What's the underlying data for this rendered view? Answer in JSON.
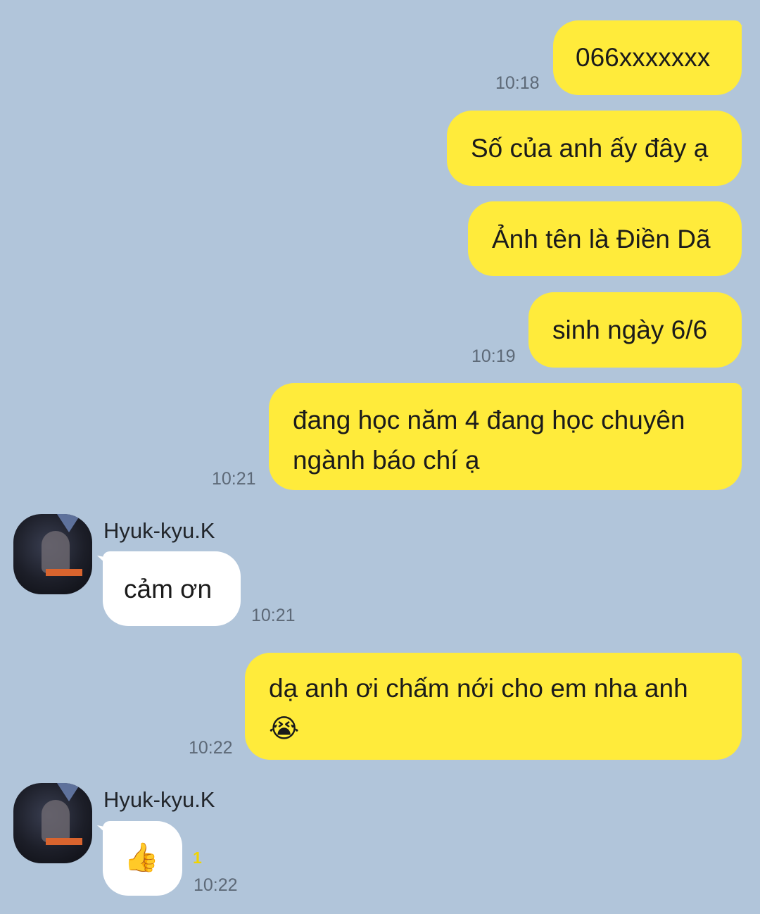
{
  "messages": [
    {
      "text": "066xxxxxxx",
      "time": "10:18"
    },
    {
      "text": "Số của anh ấy đây ạ"
    },
    {
      "text": "Ảnh tên là Điền Dã"
    },
    {
      "text": "sinh ngày 6/6",
      "time": "10:19"
    },
    {
      "line1": "đang học năm 4 đang học chuyên",
      "line2": "ngành báo chí ạ",
      "time": "10:21"
    },
    {
      "sender": "Hyuk-kyu.K",
      "text": "cảm ơn",
      "time": "10:21"
    },
    {
      "line1": "dạ anh ơi chấm nới cho em nha anh",
      "line2": "😭",
      "time": "10:22"
    },
    {
      "sender": "Hyuk-kyu.K",
      "text": "👍",
      "unread": "1",
      "time": "10:22"
    }
  ],
  "colors": {
    "background": "#b1c5da",
    "outgoing_bubble": "#ffeb3b",
    "incoming_bubble": "#ffffff",
    "unread_count": "#f1d400"
  },
  "icons": {
    "contact_avatar": "avatar-icon",
    "emoji_crying": "loudly-crying-face-icon",
    "emoji_thumbs_up": "thumbs-up-icon"
  }
}
